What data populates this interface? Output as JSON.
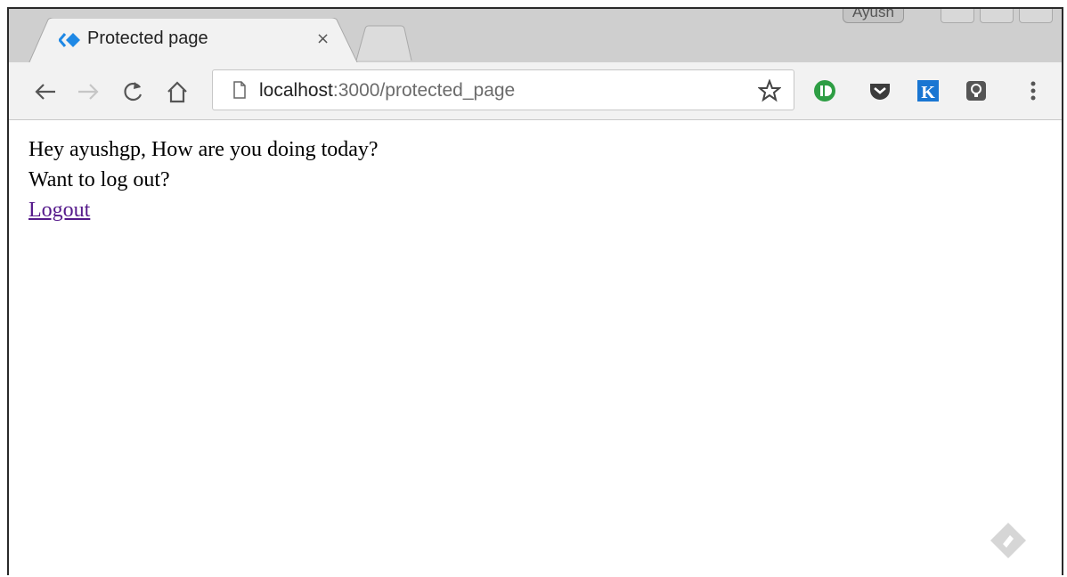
{
  "browser": {
    "tab": {
      "title": "Protected page",
      "close_glyph": "×",
      "favicon": "diamond-arrows-icon",
      "favicon_color": "#1e88e5"
    },
    "profile_name": "Ayush",
    "omnibox": {
      "host": "localhost",
      "path": ":3000/protected_page",
      "page_icon": "page-icon"
    },
    "nav": {
      "back": "back-arrow-icon",
      "forward": "forward-arrow-icon",
      "reload": "reload-icon",
      "home": "home-icon"
    },
    "extensions": [
      {
        "name": "bookmark-star-icon"
      },
      {
        "name": "green-id-extension-icon",
        "color": "#2e9e44"
      },
      {
        "name": "pocket-icon",
        "color": "#3c3c3c"
      },
      {
        "name": "k-extension-icon",
        "color": "#1976d2",
        "letter": "K"
      },
      {
        "name": "lightbulb-extension-icon",
        "color": "#555555"
      },
      {
        "name": "menu-dots-icon"
      }
    ]
  },
  "page": {
    "greeting": "Hey ayushgp, How are you doing today?",
    "prompt": "Want to log out?",
    "logout_label": "Logout",
    "link_color": "#551a8b"
  }
}
